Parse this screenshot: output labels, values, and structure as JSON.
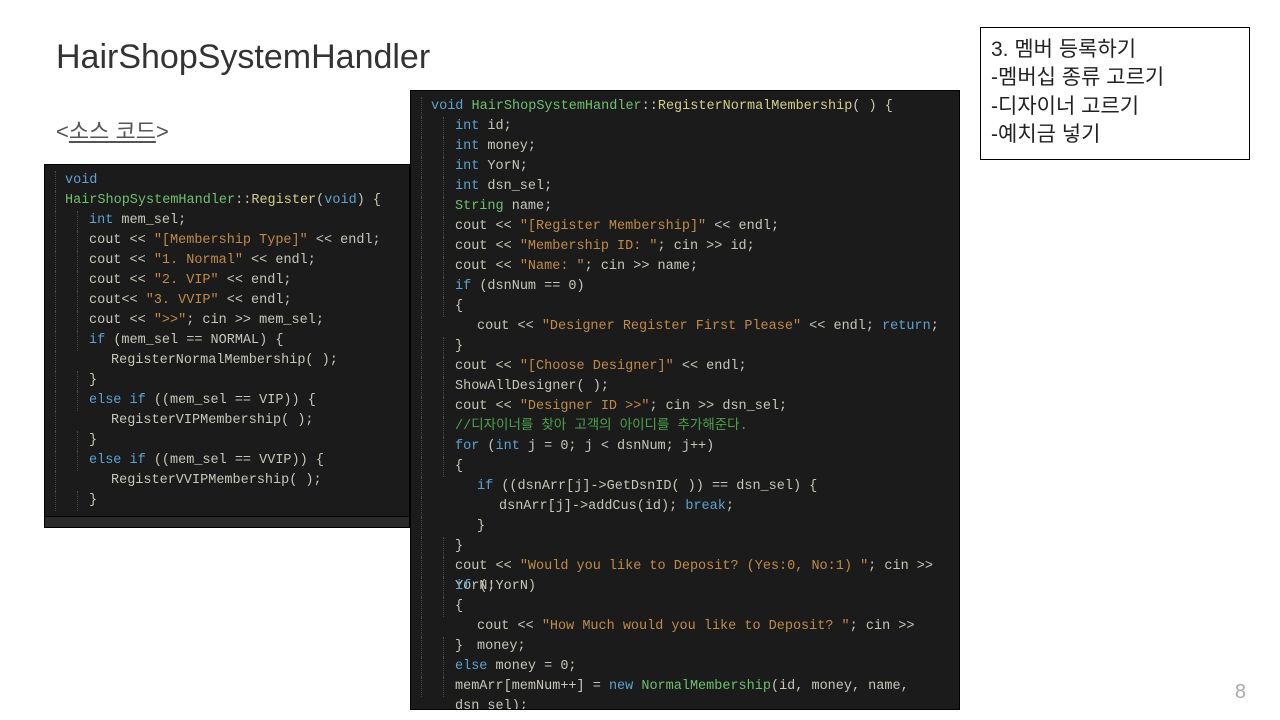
{
  "title": "HairShopSystemHandler",
  "subtitle_open": "<",
  "subtitle_text": "소스 코드",
  "subtitle_close": ">",
  "notes": {
    "l1": "3. 멤버 등록하기",
    "l2": "-멤버십 종류 고르기",
    "l3": "-디자이너 고르기",
    "l4": "-예치금 넣기"
  },
  "page_num": "8",
  "left": {
    "t": {
      "void": "void ",
      "cls": "HairShopSystemHandler",
      "sep": "::",
      "fn": "Register",
      "args_open": "(",
      "args_void": "void",
      "args_close": ") {",
      "int": "int ",
      "mem_sel": "mem_sel;",
      "cout1a": "cout << ",
      "str1": "\"[Membership Type]\"",
      "cout1b": " << endl;",
      "str2": "\"1. Normal\"",
      "str3": "\"2. VIP\"",
      "cout3a": "cout<< ",
      "str4": "\"3. VVIP\"",
      "str5": "\">>\"",
      "cin_mem": "; cin >> mem_sel;",
      "if": "if ",
      "cond1": "(mem_sel == NORMAL) {",
      "call1": "RegisterNormalMembership( );",
      "rb": "}",
      "elseif": "else if ",
      "cond2": "((mem_sel == VIP)) {",
      "call2": "RegisterVIPMembership( );",
      "cond3": "((mem_sel == VVIP)) {",
      "call3": "RegisterVVIPMembership( );"
    }
  },
  "right": {
    "t": {
      "void": "void ",
      "cls": "HairShopSystemHandler",
      "sep": "::",
      "fn": "RegisterNormalMembership",
      "sig_close": "( ) {",
      "int": "int ",
      "id": "id;",
      "money": "money;",
      "yorn": "YorN;",
      "dsn_sel": "dsn_sel;",
      "String": "String ",
      "name": "name;",
      "cout": "cout << ",
      "endl": " << endl;",
      "str_reg": "\"[Register Membership]\"",
      "str_mid": "\"Membership ID: \"",
      "cin_id": ";   cin >> id;",
      "str_name": "\"Name: \"",
      "cin_name": ";    cin >> name;",
      "if": "if ",
      "cond_dsn0": "(dsnNum == 0)",
      "lb": "{",
      "rb": "}",
      "str_first": "\"Designer Register First Please\"",
      "ret": "return",
      "semi": ";",
      "endl_ret": " << endl; ",
      "str_choose": "\"[Choose Designer]\"",
      "showall": "ShowAllDesigner( );",
      "str_did": "\"Designer ID >>\"",
      "cin_dsn": "; cin >> dsn_sel;",
      "comment": "//디자이너를 찾아 고객의 아이디를 추가해준다.",
      "for": "for ",
      "for_open": "(",
      "for_int": "int ",
      "for_body": "j = 0; j < dsnNum; j++)",
      "if_get": "((dsnArr[j]->GetDsnID( )) == dsn_sel) {",
      "addcus": "dsnArr[j]->addCus(id); ",
      "break": "break",
      "str_dep": "\"Would you like to Deposit? (Yes:0, No:1)  \"",
      "cin_yorn": "; cin >> YorN;",
      "cond_not": "(!YorN)",
      "str_how": "\"How Much would you like to Deposit?  \"",
      "cin_money": "; cin >> money;",
      "else": "else ",
      "money0": "money = 0;",
      "memarr": "memArr[memNum++] = ",
      "new": "new ",
      "normem": "NormalMembership",
      "ctor": "(id, money, name, dsn_sel);"
    }
  }
}
